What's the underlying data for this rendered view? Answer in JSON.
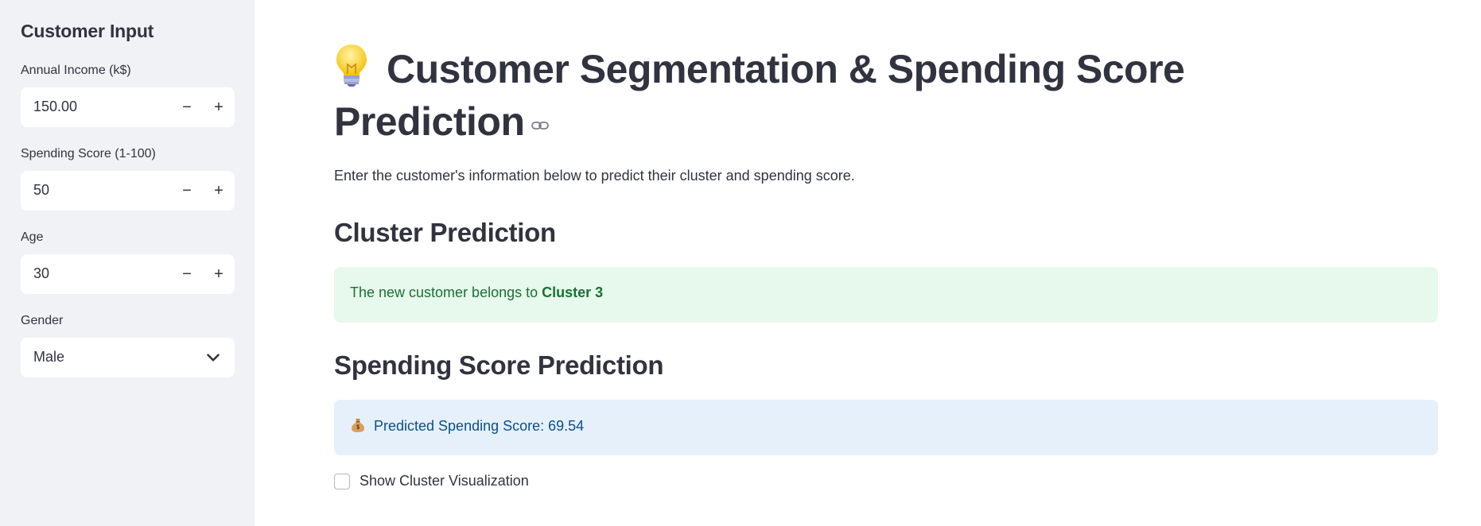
{
  "sidebar": {
    "title": "Customer Input",
    "annual_income": {
      "label": "Annual Income (k$)",
      "value": "150.00"
    },
    "spending_score": {
      "label": "Spending Score (1-100)",
      "value": "50"
    },
    "age": {
      "label": "Age",
      "value": "30"
    },
    "gender": {
      "label": "Gender",
      "value": "Male"
    },
    "stepper": {
      "minus": "−",
      "plus": "+"
    }
  },
  "main": {
    "title": "Customer Segmentation & Spending Score Prediction",
    "intro": "Enter the customer's information below to predict their cluster and spending score.",
    "cluster_section": {
      "heading": "Cluster Prediction",
      "message_prefix": "The new customer belongs to ",
      "cluster_label": "Cluster 3"
    },
    "spending_section": {
      "heading": "Spending Score Prediction",
      "message": "Predicted Spending Score: 69.54"
    },
    "visualization_checkbox": {
      "label": "Show Cluster Visualization",
      "checked": false
    }
  },
  "colors": {
    "sidebar_bg": "#f0f2f6",
    "text": "#31333f",
    "success_bg": "#e7f8ec",
    "success_text": "#177233",
    "info_bg": "#e6f0fb",
    "info_text": "#0b4f8c"
  },
  "icons": [
    "light-bulb-icon",
    "link-icon",
    "money-bag-icon",
    "chevron-down-icon"
  ]
}
